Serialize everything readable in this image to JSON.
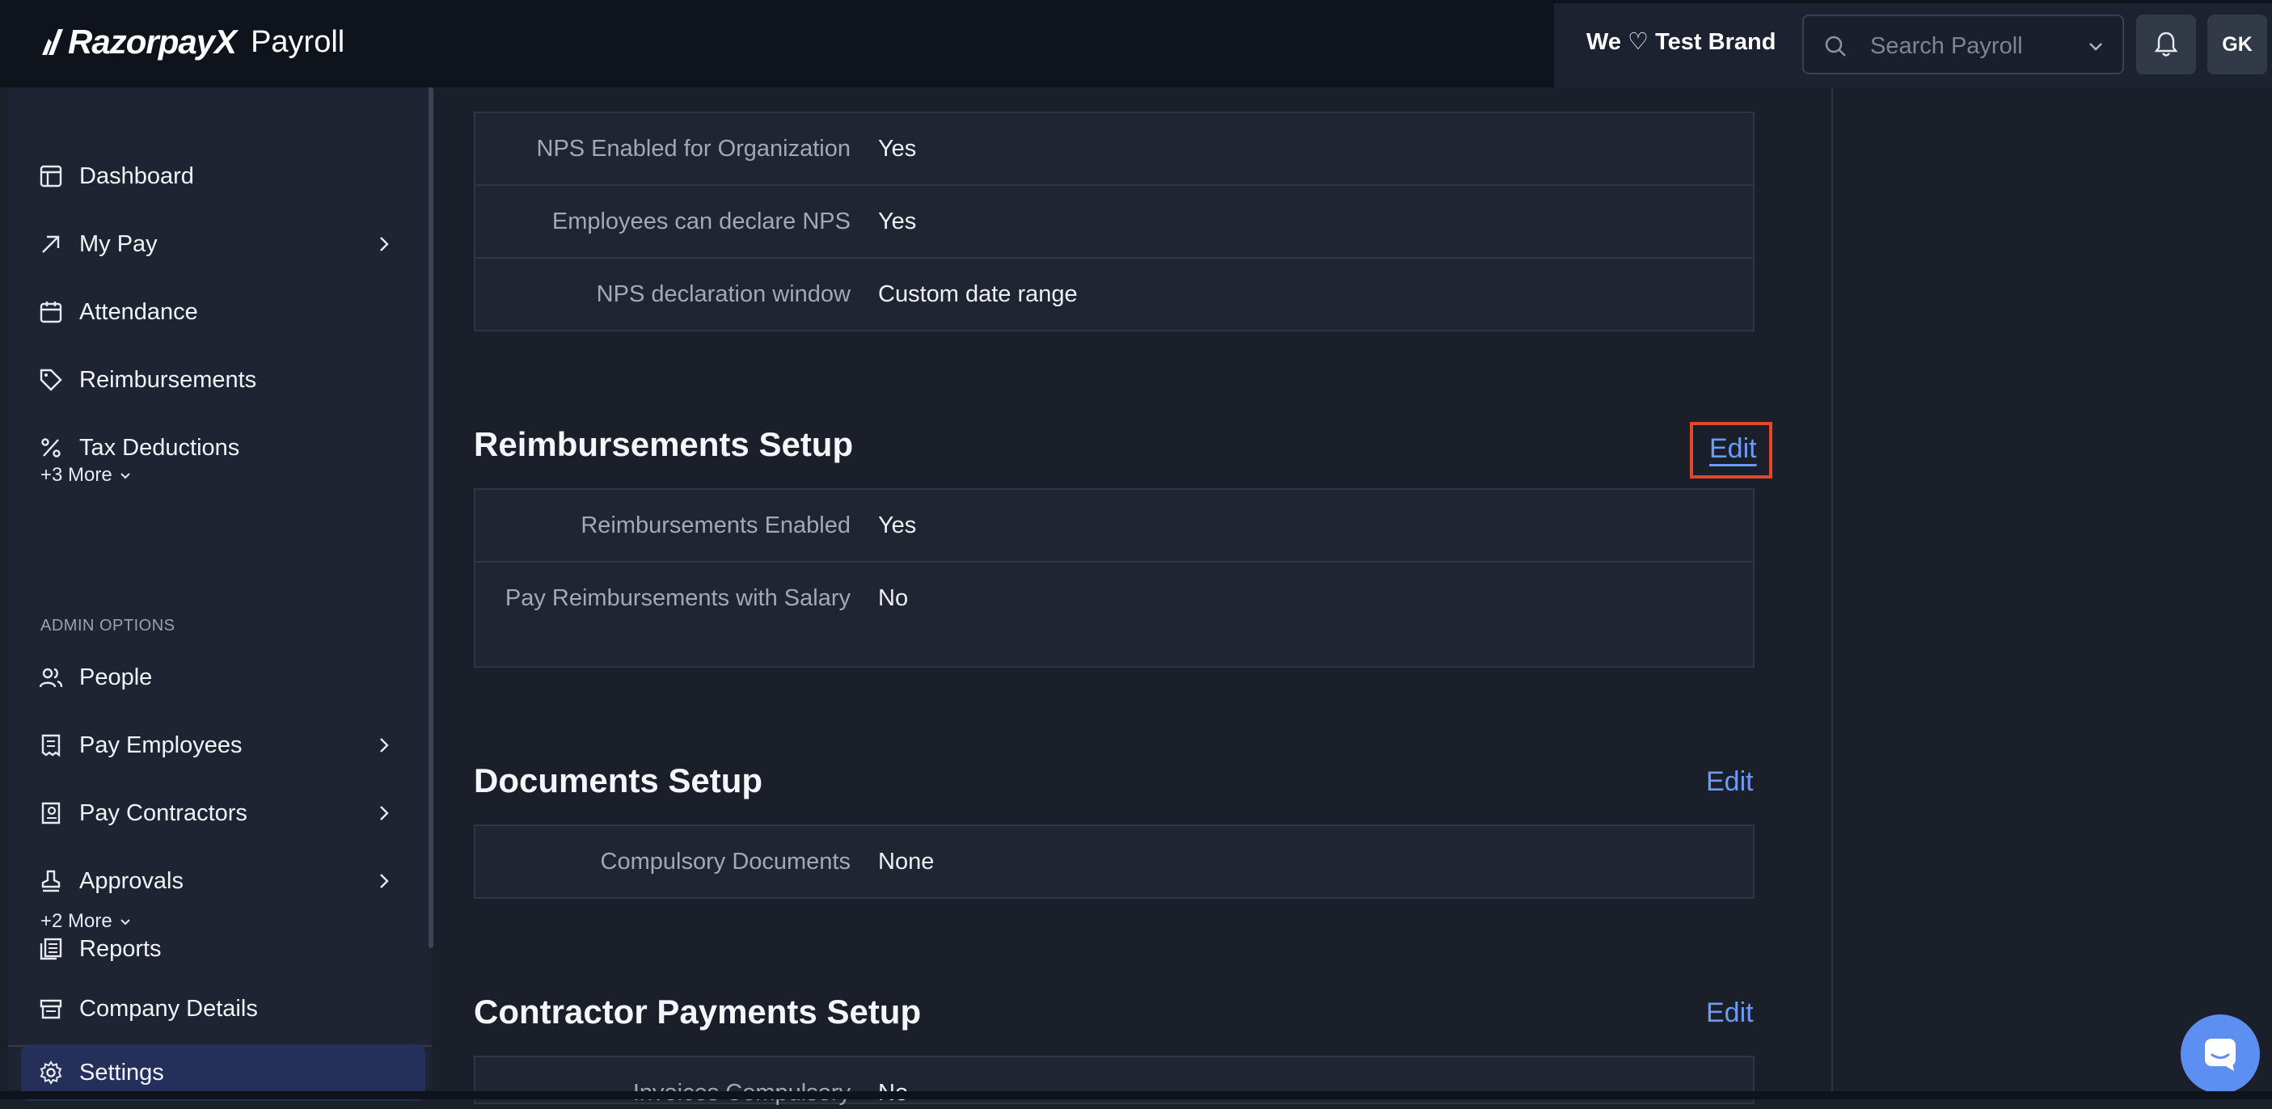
{
  "header": {
    "logo_text": "RazorpayX",
    "product": "Payroll",
    "brand": "We ♡ Test Brand",
    "search_placeholder": "Search Payroll",
    "avatar_initials": "GK"
  },
  "sidebar": {
    "items": [
      {
        "label": "Dashboard",
        "icon": "dashboard-icon"
      },
      {
        "label": "My Pay",
        "icon": "arrow-up-right-icon",
        "chevron": true
      },
      {
        "label": "Attendance",
        "icon": "calendar-icon"
      },
      {
        "label": "Reimbursements",
        "icon": "tag-icon"
      },
      {
        "label": "Tax Deductions",
        "icon": "percent-icon"
      }
    ],
    "more_1": "+3 More",
    "admin_label": "ADMIN OPTIONS",
    "admin_items": [
      {
        "label": "People",
        "icon": "people-icon"
      },
      {
        "label": "Pay Employees",
        "icon": "receipt-icon",
        "chevron": true
      },
      {
        "label": "Pay Contractors",
        "icon": "contractor-icon",
        "chevron": true
      },
      {
        "label": "Approvals",
        "icon": "stamp-icon",
        "chevron": true
      },
      {
        "label": "Reports",
        "icon": "reports-icon"
      }
    ],
    "more_2": "+2 More",
    "bottom_items": [
      {
        "label": "Company Details",
        "icon": "store-icon"
      },
      {
        "label": "Settings",
        "icon": "gear-icon",
        "active": true
      }
    ]
  },
  "nps": {
    "rows": [
      {
        "key": "NPS Enabled for Organization",
        "value": "Yes"
      },
      {
        "key": "Employees can declare NPS",
        "value": "Yes"
      },
      {
        "key": "NPS declaration window",
        "value": "Custom date range"
      }
    ]
  },
  "reimbursements": {
    "title": "Reimbursements Setup",
    "edit": "Edit",
    "rows": [
      {
        "key": "Reimbursements Enabled",
        "value": "Yes"
      },
      {
        "key": "Pay Reimbursements with Salary",
        "value": "No"
      }
    ]
  },
  "documents": {
    "title": "Documents Setup",
    "edit": "Edit",
    "rows": [
      {
        "key": "Compulsory Documents",
        "value": "None"
      }
    ]
  },
  "contractor": {
    "title": "Contractor Payments Setup",
    "edit": "Edit",
    "rows": [
      {
        "key": "Invoices Compulsory",
        "value": "No"
      }
    ]
  },
  "colors": {
    "accent": "#6b9cf5",
    "highlight": "#e0482a",
    "active_nav": "#25305a"
  }
}
